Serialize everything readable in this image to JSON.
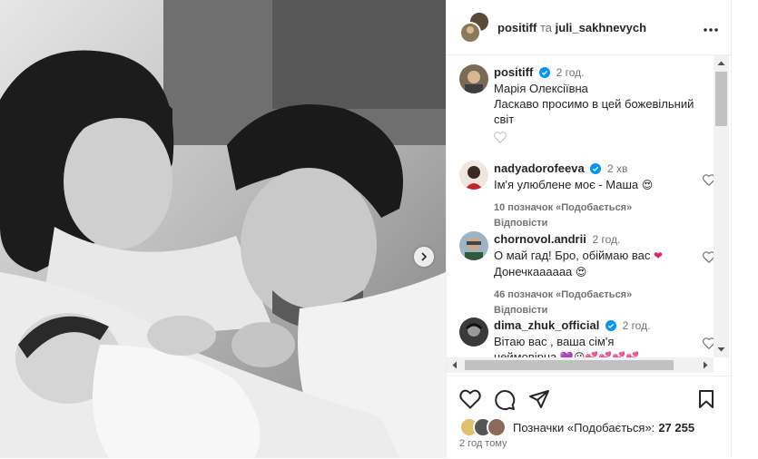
{
  "post": {
    "author": "positiff",
    "connector": "та",
    "coauthor": "juli_sakhnevych",
    "time_ago": "2 год тому",
    "likes_label": "Позначки «Подобається»:",
    "likes_count": "27 255"
  },
  "comments": [
    {
      "user": "positiff",
      "time": "2 год.",
      "lines": [
        "Марія Олексіївна",
        "Ласкаво просимо в цей божевільний світ"
      ],
      "likes": "",
      "reply": ""
    },
    {
      "user": "nadyadorofeeva",
      "time": "2 хв",
      "text": "Ім'я улюблене моє - Маша",
      "emoji": "😍",
      "likes": "10 позначок «Подобається»",
      "reply": "Відповісти"
    },
    {
      "user": "chornovol.andrii",
      "time": "2 год.",
      "text1": "О май гад! Бро, обіймаю вас",
      "emoji1": "❤",
      "text2": "Донечкаааааа",
      "emoji2": "😍",
      "likes": "46 позначок «Подобається»",
      "reply": "Відповісти"
    },
    {
      "user": "dima_zhuk_official",
      "time": "2 год.",
      "text1": "Вітаю вас , ваша сім'я",
      "text2": "неймовірна",
      "emoji": "💜😘💕💕💕💕"
    }
  ],
  "icons": {
    "more": "more-horizontal-icon",
    "verified": "verified-badge-icon",
    "heart": "heart-icon",
    "comment": "comment-icon",
    "share": "share-icon",
    "save": "bookmark-icon",
    "next": "chevron-right-icon"
  },
  "colors": {
    "verified": "#0095f6",
    "text": "#262626",
    "muted": "#737373",
    "heart_emoji": "#e0245e"
  }
}
